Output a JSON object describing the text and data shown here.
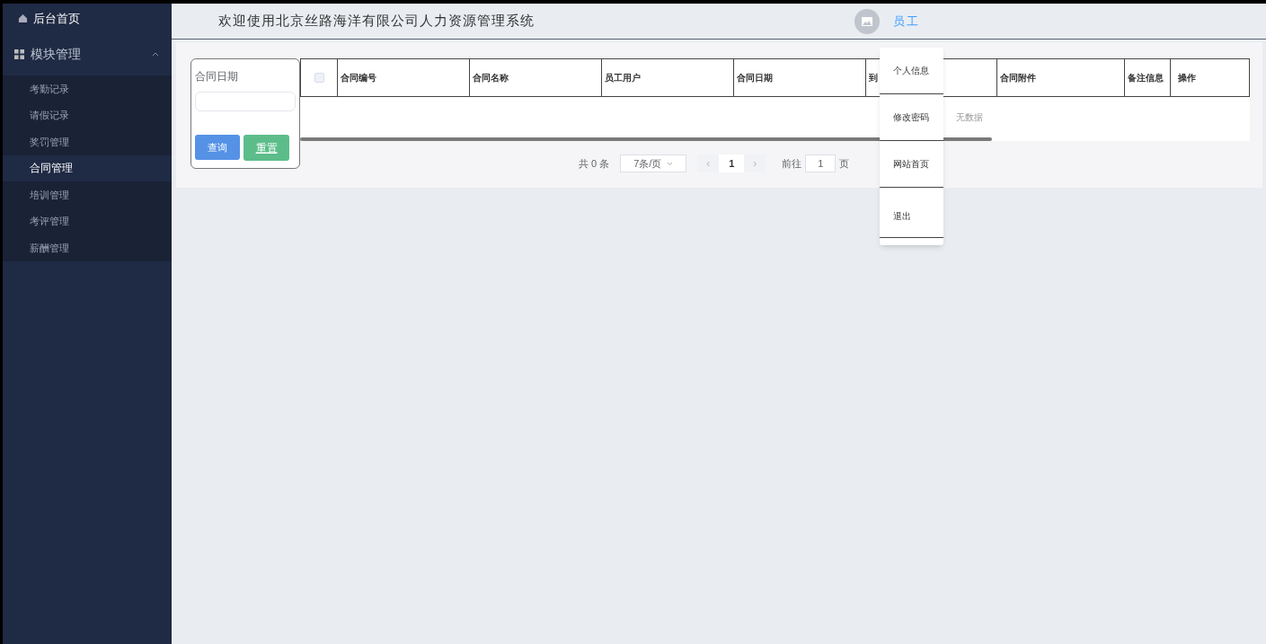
{
  "sidebar": {
    "home": "后台首页",
    "group": {
      "label": "模块管理",
      "expanded": true
    },
    "items": [
      {
        "label": "考勤记录",
        "selected": false
      },
      {
        "label": "请假记录",
        "selected": false
      },
      {
        "label": "奖罚管理",
        "selected": false
      },
      {
        "label": "合同管理",
        "selected": true
      },
      {
        "label": "培训管理",
        "selected": false
      },
      {
        "label": "考评管理",
        "selected": false
      },
      {
        "label": "薪酬管理",
        "selected": false
      }
    ]
  },
  "header": {
    "title": "欢迎使用北京丝路海洋有限公司人力资源管理系统",
    "user": "员工"
  },
  "user_menu": [
    "个人信息",
    "修改密码",
    "网站首页",
    "退出"
  ],
  "filter": {
    "label": "合同日期",
    "query_button": "查询",
    "reset_button": "重置"
  },
  "table": {
    "select_all": {
      "checked": false
    },
    "columns": [
      "合同编号",
      "合同名称",
      "员工用户",
      "合同日期",
      "到",
      "合同附件",
      "备注信息"
    ],
    "action_column": "操作",
    "empty_text": "无数据"
  },
  "pagination": {
    "total": "共 0 条",
    "page_size": "7条/页",
    "prev": "‹",
    "page": "1",
    "next": "›",
    "goto_label": "前往",
    "goto_value": "1",
    "goto_suffix": "页"
  }
}
